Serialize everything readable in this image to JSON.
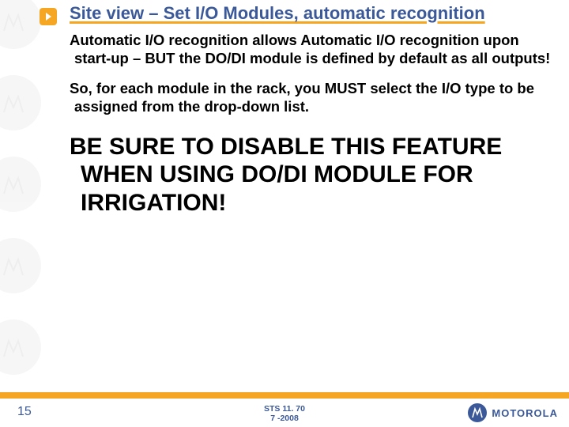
{
  "title": "Site view – Set I/O Modules, automatic recognition",
  "para1": "Automatic I/O recognition allows Automatic I/O recognition upon start-up – BUT the DO/DI module is defined by default as all outputs!",
  "para2": "So, for each module in the rack, you MUST select the I/O type to be assigned from the drop-down list.",
  "warning": "BE SURE TO DISABLE THIS FEATURE WHEN USING DO/DI MODULE FOR IRRIGATION!",
  "footer": {
    "page": "15",
    "line1": "STS 11. 70",
    "line2": "7 -2008",
    "brand": "MOTOROLA"
  }
}
